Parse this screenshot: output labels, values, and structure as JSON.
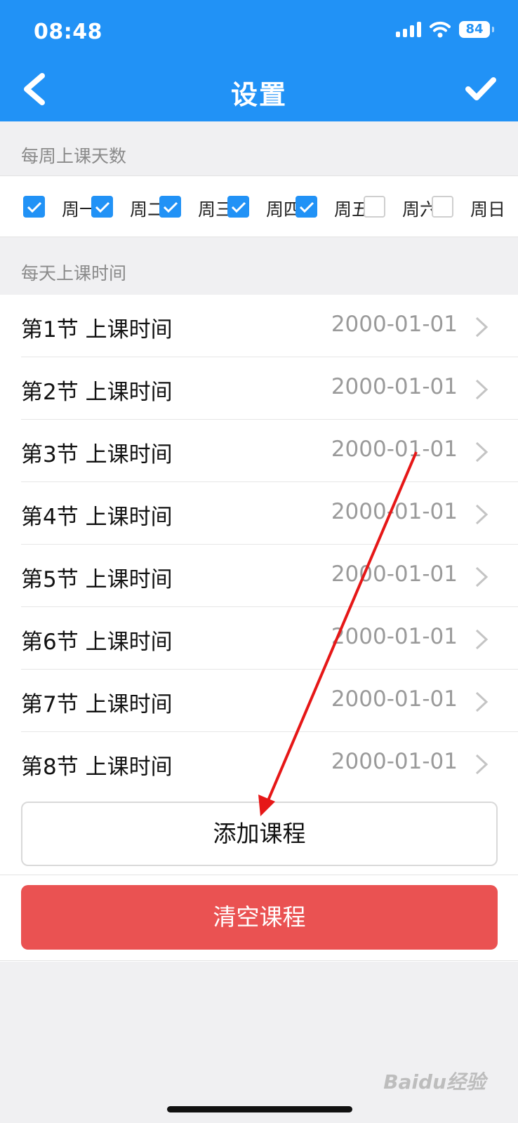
{
  "status_bar": {
    "time": "08:48",
    "battery": "84"
  },
  "nav": {
    "title": "设置"
  },
  "sections": {
    "days_title": "每周上课天数",
    "times_title": "每天上课时间"
  },
  "days": [
    {
      "label": "周一",
      "checked": true
    },
    {
      "label": "周二",
      "checked": true
    },
    {
      "label": "周三",
      "checked": true
    },
    {
      "label": "周四",
      "checked": true
    },
    {
      "label": "周五",
      "checked": true
    },
    {
      "label": "周六",
      "checked": false
    },
    {
      "label": "周日",
      "checked": false
    }
  ],
  "periods": [
    {
      "label": "第1节 上课时间",
      "value": "2000-01-01"
    },
    {
      "label": "第2节 上课时间",
      "value": "2000-01-01"
    },
    {
      "label": "第3节 上课时间",
      "value": "2000-01-01"
    },
    {
      "label": "第4节 上课时间",
      "value": "2000-01-01"
    },
    {
      "label": "第5节 上课时间",
      "value": "2000-01-01"
    },
    {
      "label": "第6节 上课时间",
      "value": "2000-01-01"
    },
    {
      "label": "第7节 上课时间",
      "value": "2000-01-01"
    },
    {
      "label": "第8节 上课时间",
      "value": "2000-01-01"
    }
  ],
  "buttons": {
    "add": "添加课程",
    "clear": "清空课程"
  },
  "watermark": "Baidu经验",
  "colors": {
    "primary": "#2192f6",
    "danger": "#ea5252",
    "annotation": "#e61717"
  }
}
